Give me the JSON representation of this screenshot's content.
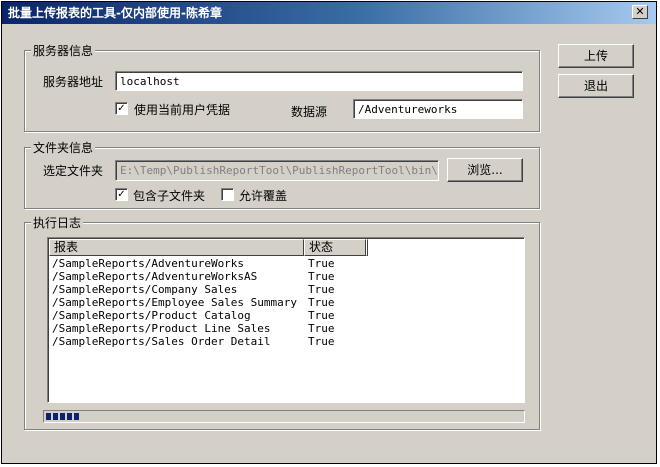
{
  "window": {
    "title": "批量上传报表的工具-仅内部使用-陈希章",
    "close_glyph": "✕"
  },
  "server_group": {
    "legend": "服务器信息",
    "address_label": "服务器地址",
    "address_value": "localhost",
    "use_credentials_label": "使用当前用户凭据",
    "use_credentials_checked": true,
    "datasource_label": "数据源",
    "datasource_value": "/Adventureworks"
  },
  "folder_group": {
    "legend": "文件夹信息",
    "folder_label": "选定文件夹",
    "folder_value": "E:\\Temp\\PublishReportTool\\PublishReportTool\\bin\\Debug",
    "browse_label": "浏览...",
    "include_subfolders_label": "包含子文件夹",
    "include_subfolders_checked": true,
    "allow_overwrite_label": "允许覆盖",
    "allow_overwrite_checked": false
  },
  "log_group": {
    "legend": "执行日志",
    "columns": [
      "报表",
      "状态"
    ],
    "rows": [
      {
        "report": "/SampleReports/AdventureWorks",
        "status": "True"
      },
      {
        "report": "/SampleReports/AdventureWorksAS",
        "status": "True"
      },
      {
        "report": "/SampleReports/Company Sales",
        "status": "True"
      },
      {
        "report": "/SampleReports/Employee Sales Summary",
        "status": "True"
      },
      {
        "report": "/SampleReports/Product Catalog",
        "status": "True"
      },
      {
        "report": "/SampleReports/Product Line Sales",
        "status": "True"
      },
      {
        "report": "/SampleReports/Sales Order Detail",
        "status": "True"
      }
    ],
    "progress_percent": 8
  },
  "actions": {
    "upload_label": "上传",
    "exit_label": "退出"
  },
  "colors": {
    "title_gradient_start": "#0a246a",
    "title_gradient_end": "#a6caf0",
    "dialog_face": "#d4d0c8",
    "progress_fill": "#0a246a"
  }
}
